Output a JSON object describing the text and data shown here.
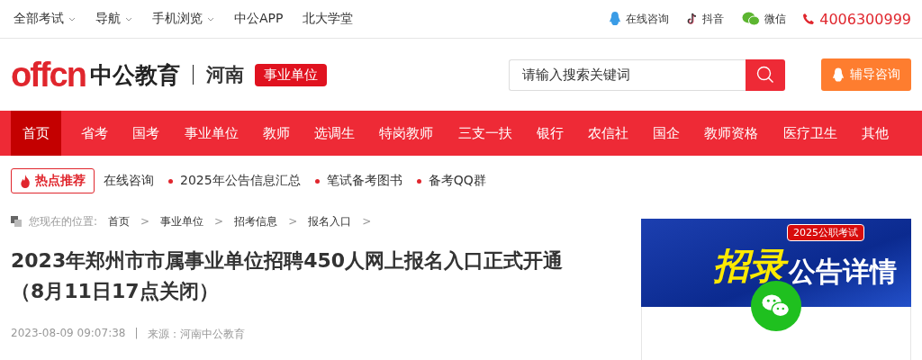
{
  "top_links": [
    {
      "label": "全部考试",
      "dropdown": true
    },
    {
      "label": "导航",
      "dropdown": true
    },
    {
      "label": "手机浏览",
      "dropdown": true
    },
    {
      "label": "中公APP",
      "dropdown": false
    },
    {
      "label": "北大学堂",
      "dropdown": false
    }
  ],
  "contacts": [
    {
      "kind": "qq",
      "label": "在线咨询"
    },
    {
      "kind": "douyin",
      "label": "抖音"
    },
    {
      "kind": "wechat",
      "label": "微信"
    },
    {
      "kind": "phone",
      "label": "4006300999"
    }
  ],
  "logo": {
    "mark": "offcn",
    "name": "中公教育",
    "region": "河南",
    "badge": "事业单位"
  },
  "search": {
    "placeholder": "请输入搜索关键词"
  },
  "consult_button": "辅导咨询",
  "nav": [
    {
      "label": "首页",
      "selected": true
    },
    {
      "label": "省考",
      "selected": false
    },
    {
      "label": "国考",
      "selected": false
    },
    {
      "label": "事业单位",
      "selected": false
    },
    {
      "label": "教师",
      "selected": false
    },
    {
      "label": "选调生",
      "selected": false
    },
    {
      "label": "特岗教师",
      "selected": false
    },
    {
      "label": "三支一扶",
      "selected": false
    },
    {
      "label": "银行",
      "selected": false
    },
    {
      "label": "农信社",
      "selected": false
    },
    {
      "label": "国企",
      "selected": false
    },
    {
      "label": "教师资格",
      "selected": false
    },
    {
      "label": "医疗卫生",
      "selected": false
    },
    {
      "label": "其他",
      "selected": false
    }
  ],
  "hot": {
    "title": "热点推荐",
    "links": [
      {
        "label": "在线咨询",
        "dot": false
      },
      {
        "label": "2025年公告信息汇总",
        "dot": true
      },
      {
        "label": "笔试备考图书",
        "dot": true
      },
      {
        "label": "备考QQ群",
        "dot": true
      }
    ]
  },
  "breadcrumb": {
    "prefix": "您现在的位置:",
    "items": [
      "首页",
      "事业单位",
      "招考信息",
      "报名入口"
    ],
    "separator": ">"
  },
  "article": {
    "title": "2023年郑州市市属事业单位招聘450人网上报名入口正式开通（8月11日17点关闭）",
    "date": "2023-08-09 09:07:38",
    "divider": "|",
    "source": "来源：河南中公教育"
  },
  "banner": {
    "tag": "2025公职考试",
    "big": "招录",
    "rest": "公告详情"
  }
}
